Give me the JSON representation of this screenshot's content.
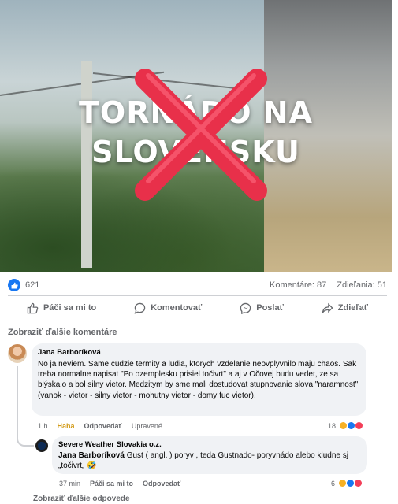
{
  "media": {
    "overlay_line1": "TORNÁDO NA",
    "overlay_line2": "SLOVENSKU"
  },
  "stats": {
    "reactions_count": "621",
    "comments": "Komentáre: 87",
    "shares": "Zdieľania: 51"
  },
  "actions": {
    "like": "Páči sa mi to",
    "comment": "Komentovať",
    "send": "Poslať",
    "share": "Zdieľať"
  },
  "show_more_comments": "Zobraziť ďalšie komentáre",
  "comment": {
    "author": "Jana Barboríková",
    "text": "No ja neviem. Same cudzie termity a ludia, ktorych vzdelanie neovplyvnilo maju chaos. Sak treba normalne napisat \"Po ozemplesku prisiel točivrt\" a aj v Očovej budu vedet, ze sa blýskalo a bol silny vietor. Medzitym by sme mali dostudovat stupnovanie slova \"naramnost\" (vanok - vietor - silny vietor - mohutny vietor - domy fuc vietor).",
    "time": "1 h",
    "reaction_label": "Haha",
    "reply": "Odpovedať",
    "edited": "Upravené",
    "reaction_count": "18"
  },
  "reply": {
    "author": "Severe Weather Slovakia o.z.",
    "mention": "Jana Barboríková",
    "text": " Gust ( angl. ) poryv , teda Gustnado- poryvnádo alebo kludne sj „točivrt„ 🤣",
    "time": "37 min",
    "like": "Páči sa mi to",
    "reply_label": "Odpovedať",
    "reaction_count": "6"
  },
  "show_more_replies": "Zobraziť ďalšie odpovede",
  "colors": {
    "facebook_blue": "#1877f2",
    "haha_yellow": "#f7b125",
    "love_red": "#f33e58",
    "x_mark_red": "#e8304a"
  }
}
